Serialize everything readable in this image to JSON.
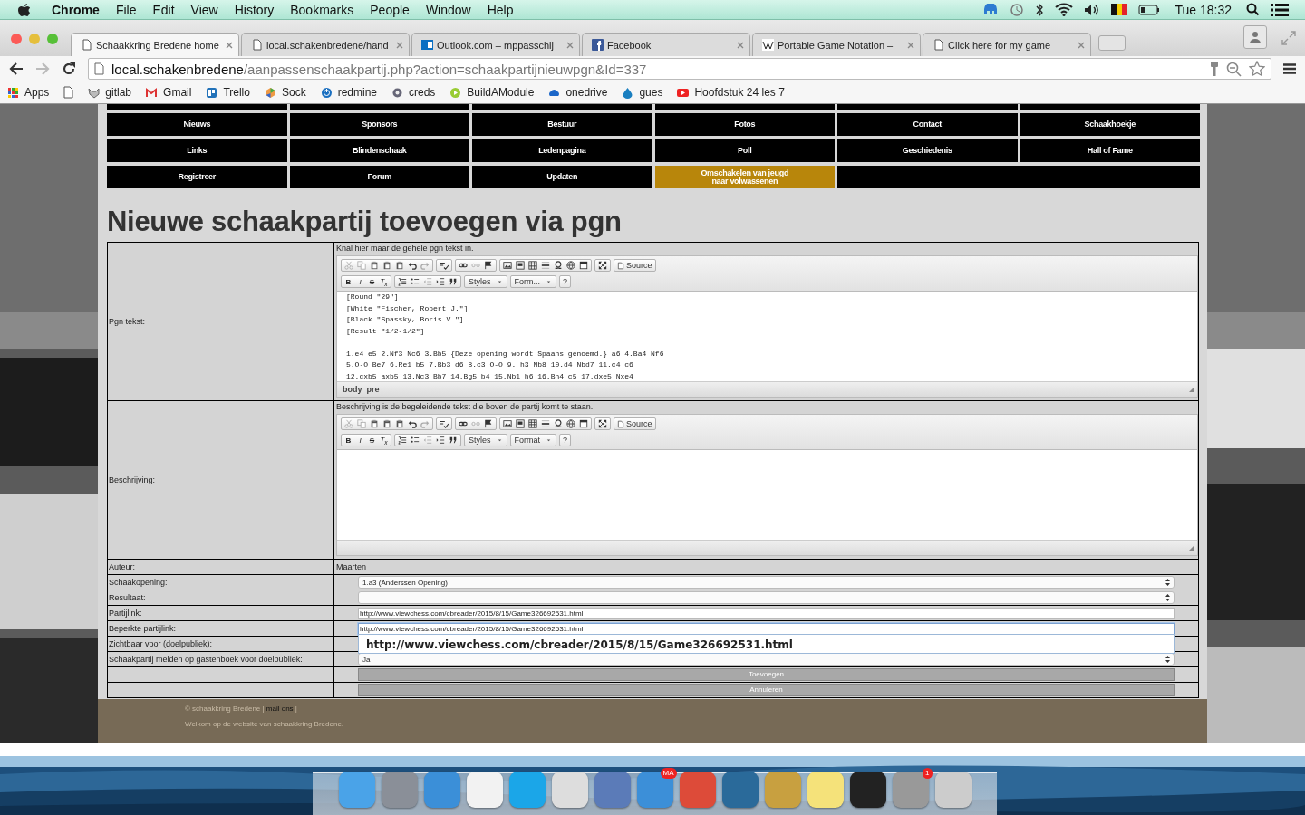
{
  "menu_bar": {
    "app": "Chrome",
    "items": [
      "File",
      "Edit",
      "View",
      "History",
      "Bookmarks",
      "People",
      "Window",
      "Help"
    ],
    "clock": "Tue 18:32"
  },
  "tabs": [
    {
      "title": "Schaakkring Bredene home",
      "selected": true
    },
    {
      "title": "local.schakenbredene/hand",
      "selected": false
    },
    {
      "title": "Outlook.com – mppasschij",
      "selected": false
    },
    {
      "title": "Facebook",
      "selected": false
    },
    {
      "title": "Portable Game Notation –",
      "selected": false
    },
    {
      "title": "Click here for my game",
      "selected": false
    }
  ],
  "address_bar": {
    "host": "local.schakenbredene",
    "path": "/aanpassenschaakpartij.php?action=schaakpartijnieuwpgn&Id=337"
  },
  "bookmarks": [
    "Apps",
    "gitlab",
    "Gmail",
    "Trello",
    "Sock",
    "redmine",
    "creds",
    "BuildAModule",
    "onedrive",
    "gues",
    "Hoofdstuk 24 les 7"
  ],
  "nav": [
    {
      "label": "Nieuws",
      "highlighted": false
    },
    {
      "label": "Sponsors",
      "highlighted": false
    },
    {
      "label": "Bestuur",
      "highlighted": false
    },
    {
      "label": "Fotos",
      "highlighted": false
    },
    {
      "label": "Contact",
      "highlighted": false
    },
    {
      "label": "Schaakhoekje",
      "highlighted": false
    },
    {
      "label": "Links",
      "highlighted": false
    },
    {
      "label": "Blindenschaak",
      "highlighted": false
    },
    {
      "label": "Ledenpagina",
      "highlighted": false
    },
    {
      "label": "Poll",
      "highlighted": false
    },
    {
      "label": "Geschiedenis",
      "highlighted": false
    },
    {
      "label": "Hall of Fame",
      "highlighted": false
    },
    {
      "label": "Registreer",
      "highlighted": false
    },
    {
      "label": "Forum",
      "highlighted": false
    },
    {
      "label": "Updaten",
      "highlighted": false
    },
    {
      "label": "Omschakelen van jeugd\nnaar volwassenen",
      "highlighted": true
    }
  ],
  "heading": "Nieuwe schaakpartij toevoegen via pgn",
  "editors": [
    {
      "label": "Pgn tekst:",
      "hint": "Knal hier maar de gehele pgn tekst in.",
      "toolbar": {
        "bold": "B",
        "italic": "I",
        "strike": "S",
        "clear": "T$_{x}$",
        "source": "Source",
        "styles": "Styles",
        "format": "Form...",
        "help": "?"
      },
      "headers": [
        "[Round \"29\"]",
        "[White \"Fischer, Robert J.\"]",
        "[Black \"Spassky, Boris V.\"]",
        "[Result \"1/2-1/2\"]"
      ],
      "moves": [
        "1.e4 e5 2.Nf3 Nc6 3.Bb5 {Deze opening wordt Spaans genoemd.} a6 4.Ba4 Nf6",
        "5.O-O Be7 6.Re1 b5 7.Bb3 d6 8.c3 O-O 9. h3 Nb8 10.d4 Nbd7 11.c4 c6",
        "12.cxb5 axb5 13.Nc3 Bb7 14.Bg5 b4 15.Nb1 h6 16.Bh4 c5 17.dxe5 Nxe4"
      ],
      "path": [
        "body",
        "pre"
      ]
    },
    {
      "label": "Beschrijving:",
      "hint": "Beschrijving is de begeleidende tekst die boven de partij komt te staan.",
      "toolbar": {
        "bold": "B",
        "italic": "I",
        "strike": "S",
        "clear": "T$_{x}$",
        "source": "Source",
        "styles": "Styles",
        "format": "Format",
        "help": "?"
      }
    }
  ],
  "fields": [
    {
      "label": "Auteur:",
      "kind": "text",
      "value": "Maarten"
    },
    {
      "label": "Schaakopening:",
      "kind": "select",
      "value": "1.a3 (Anderssen Opening)"
    },
    {
      "label": "Resultaat:",
      "kind": "select"
    },
    {
      "label": "Partijlink:",
      "kind": "input",
      "value": "http://www.viewchess.com/cbreader/2015/8/15/Game326692531.html",
      "focused": false
    },
    {
      "label": "Beperkte partijlink:",
      "kind": "input",
      "value": "http://www.viewchess.com/cbreader/2015/8/15/Game326692531.html",
      "focused": true,
      "suggestion": "http://www.viewchess.com/cbreader/2015/8/15/Game326692531.html"
    },
    {
      "label": "Zichtbaar voor (doelpubliek):",
      "kind": "covered"
    },
    {
      "label": "Schaakpartij melden op gastenboek voor doelpubliek:",
      "kind": "select",
      "value": "Ja"
    }
  ],
  "buttons": [
    "Toevoegen",
    "Annuleren"
  ],
  "footer": {
    "copyright": "© schaakkring Bredene |",
    "link": "mail ons",
    "separator": "|",
    "welcome": "Welkom op de website van schaakkring Bredene."
  },
  "dock": {
    "mail_badge": "MA",
    "notification_badge": "1"
  }
}
